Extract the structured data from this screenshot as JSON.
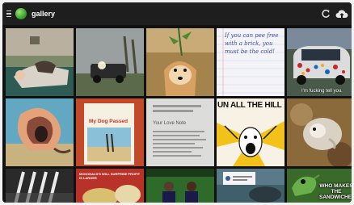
{
  "app": {
    "title": "gallery",
    "brand_color": "#3aa827"
  },
  "toolbar": {
    "menu_icon": "hamburger-icon",
    "refresh_icon": "refresh-icon",
    "upload_icon": "upload-icon"
  },
  "gallery": {
    "tiles": [
      {
        "caption": ""
      },
      {
        "caption": ""
      },
      {
        "caption": ""
      },
      {
        "caption": "If you can pee free with a brick, you must be the cold!"
      },
      {
        "caption": "I'm fucking tell you."
      },
      {
        "caption": ""
      },
      {
        "caption": "My Dog Passed"
      },
      {
        "caption": "Your Love Note"
      },
      {
        "caption": "UN ALL THE HILL"
      },
      {
        "caption": ""
      },
      {
        "caption": ""
      },
      {
        "caption": "MCDONALD'S WILL SURPRISE PROFIT IS LARGER"
      },
      {
        "caption": ""
      },
      {
        "caption": ""
      },
      {
        "caption": "WHO MAKES THE SANDWICHES?"
      }
    ]
  }
}
